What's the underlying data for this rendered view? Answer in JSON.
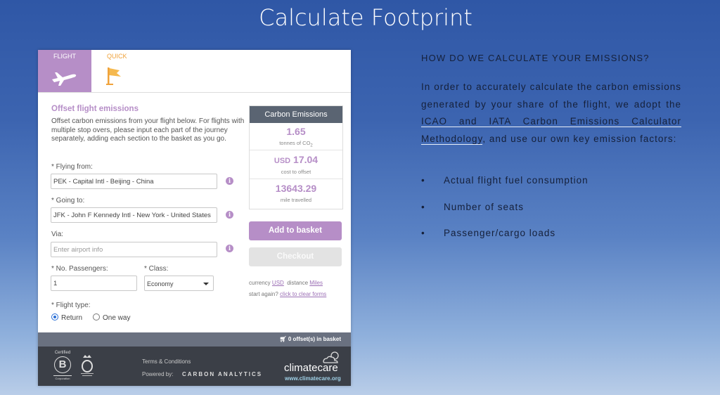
{
  "page": {
    "title": "Calculate Footprint"
  },
  "tabs": [
    {
      "label": "FLIGHT",
      "icon": "airplane-icon",
      "active": true
    },
    {
      "label": "QUICK",
      "icon": "flag-icon",
      "active": false
    }
  ],
  "form": {
    "title": "Offset flight emissions",
    "intro": "Offset carbon emissions from your flight below. For flights with multiple stop overs, please input each part of the journey separately, adding each section to the basket as you go.",
    "flying_from": {
      "label": "* Flying from:",
      "value": "PEK - Capital Intl - Beijing - China"
    },
    "going_to": {
      "label": "* Going to:",
      "value": "JFK - John F Kennedy Intl - New York - United States"
    },
    "via": {
      "label": "Via:",
      "placeholder": "Enter airport info"
    },
    "passengers": {
      "label": "* No. Passengers:",
      "value": "1"
    },
    "class": {
      "label": "* Class:",
      "value": "Economy"
    },
    "flight_type": {
      "label": "* Flight type:",
      "options": [
        "Return",
        "One way"
      ],
      "selected": "Return"
    }
  },
  "emissions": {
    "header": "Carbon Emissions",
    "tonnes": {
      "value": "1.65",
      "unit_prefix": "tonnes of CO",
      "unit_sub": "2"
    },
    "cost": {
      "currency": "USD",
      "value": "17.04",
      "unit": "cost to offset"
    },
    "miles": {
      "value": "13643.29",
      "unit": "mile travelled"
    }
  },
  "buttons": {
    "add_to_basket": "Add to basket",
    "checkout": "Checkout"
  },
  "options": {
    "currency_label": "currency",
    "currency_value": "USD",
    "distance_label": "distance",
    "distance_value": "Miles",
    "start_again": "start again?",
    "clear_forms": "click to clear forms"
  },
  "basket": {
    "text": "0 offset(s) in basket"
  },
  "footer": {
    "bcorp_label": "Certified",
    "bcorp_sub": "Corporation",
    "terms": "Terms & Conditions",
    "powered_by": "Powered by:",
    "carbon_analytics": "CARBON ANALYTICS",
    "climatecare": "climatecare",
    "climatecare_url": "www.climatecare.org"
  },
  "info": {
    "heading": "HOW DO WE CALCULATE YOUR EMISSIONS?",
    "para_pre": "In order to accurately calculate the carbon emissions generated by your share of the flight, we adopt the ",
    "para_link": "ICAO and IATA Carbon Emissions Calculator Methodology",
    "para_post": ", and use our own key emission factors:",
    "bullets": [
      "Actual flight fuel consumption",
      "Number of seats",
      "Passenger/cargo loads"
    ]
  },
  "colors": {
    "accent_purple": "#b68ec7",
    "quick_orange": "#f0a23a",
    "header_grey": "#5a6472",
    "footer_dark": "#3b3f47"
  }
}
